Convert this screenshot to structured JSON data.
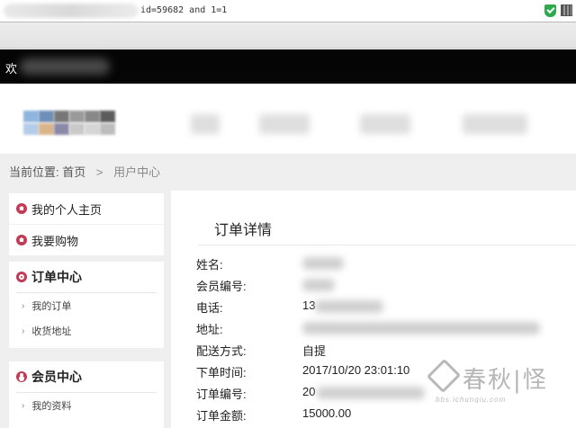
{
  "browser": {
    "url_fragment": "id=59682 and 1=1"
  },
  "topbar": {
    "welcome_prefix": "欢"
  },
  "breadcrumb": {
    "label": "当前位置:",
    "home": "首页",
    "separator": ">",
    "current": "用户中心"
  },
  "sidebar": {
    "personal_home": "我的个人主页",
    "shopping": "我要购物",
    "order_center": "订单中心",
    "my_orders": "我的订单",
    "shipping_address": "收货地址",
    "member_center": "会员中心",
    "my_profile": "我的资料",
    "sub_arrow": "›"
  },
  "order": {
    "title": "订单详情",
    "fields": [
      {
        "label": "姓名:",
        "value": ""
      },
      {
        "label": "会员编号:",
        "value": ""
      },
      {
        "label": "电话:",
        "value": "13"
      },
      {
        "label": "地址:",
        "value": ""
      },
      {
        "label": "配送方式:",
        "value": "自提"
      },
      {
        "label": "下单时间:",
        "value": "2017/10/20 23:01:10"
      },
      {
        "label": "订单编号:",
        "value": "20"
      },
      {
        "label": "订单金额:",
        "value": "15000.00"
      }
    ]
  },
  "watermark": {
    "brand": "春秋|怪",
    "url": "bbs.ichunqiu.com"
  },
  "colors": {
    "accent_icon": "#c23a55",
    "topbar_bg": "#050505",
    "security_green": "#2eaa4d"
  }
}
